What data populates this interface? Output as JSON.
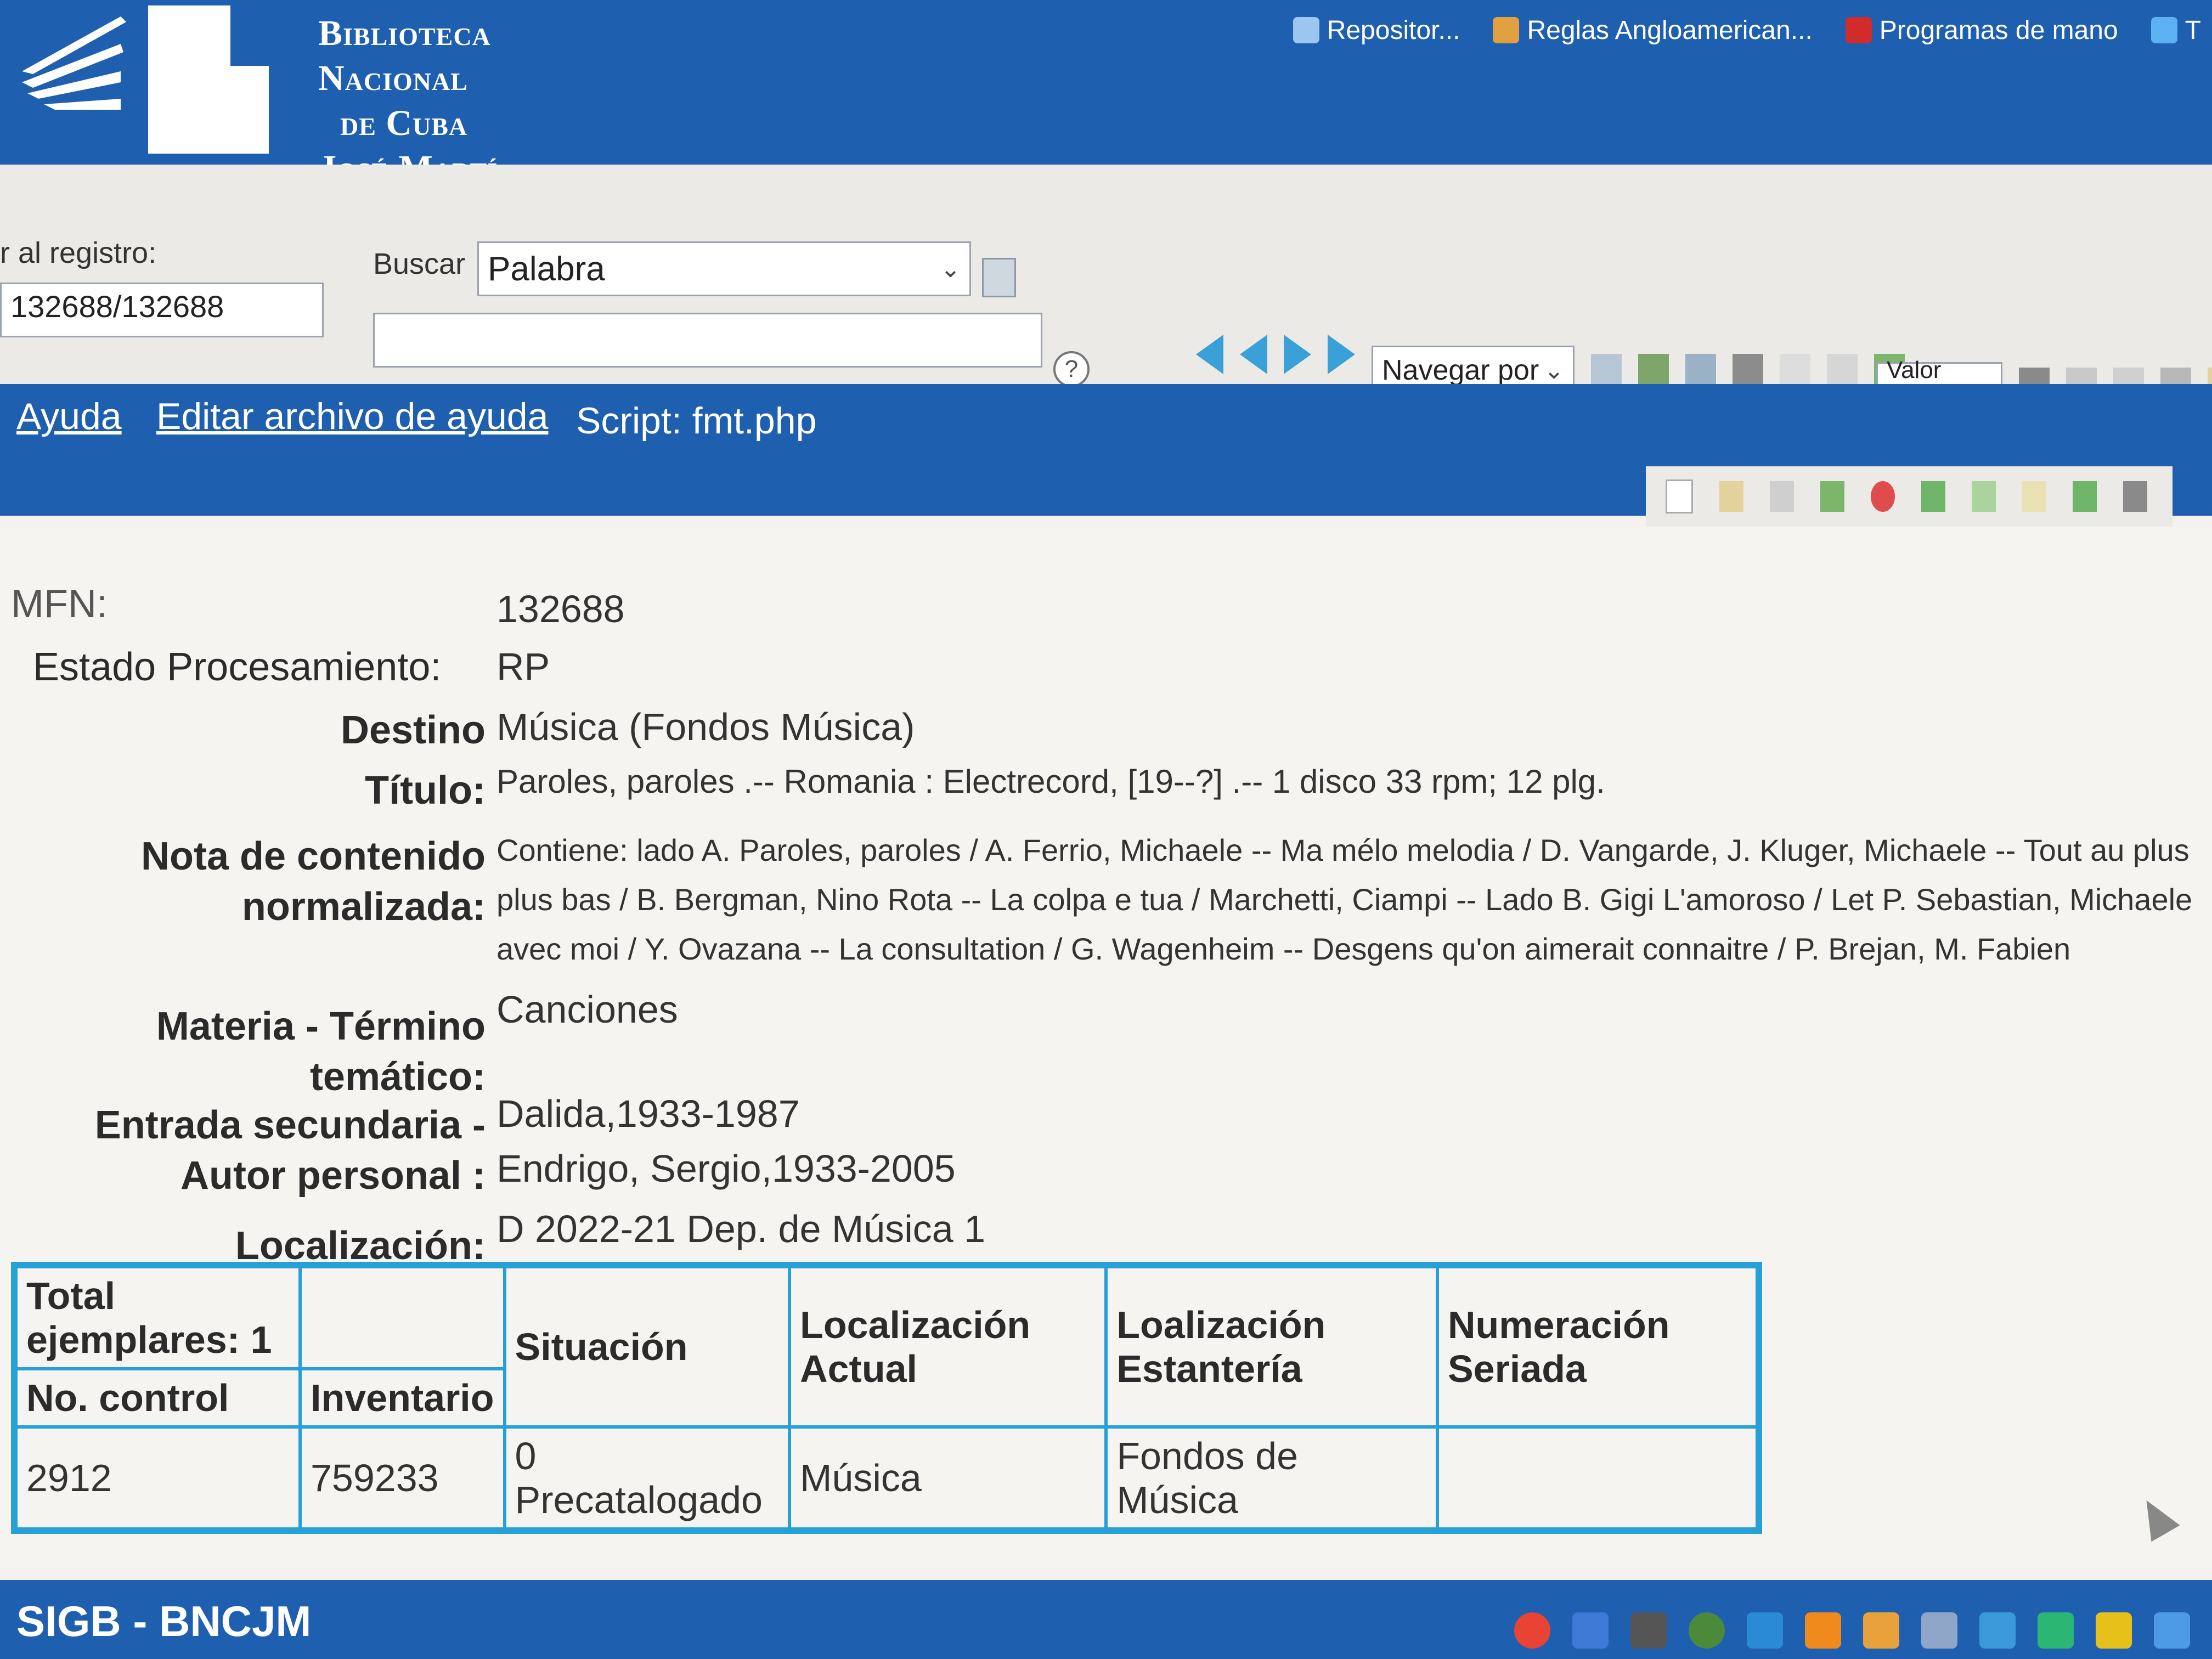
{
  "logo": {
    "lines": [
      "Biblioteca",
      "Nacional",
      "de Cuba",
      "José Martí"
    ]
  },
  "bookmarks": [
    {
      "label": "Repositor...",
      "icon": "repository-icon",
      "color": "#9cc5f0"
    },
    {
      "label": "Reglas Angloamerican...",
      "icon": "book-icon",
      "color": "#e0a040"
    },
    {
      "label": "Programas de mano",
      "icon": "pdf-icon",
      "color": "#d22b2b"
    },
    {
      "label": "T",
      "icon": "twitter-icon",
      "color": "#5bb1f1"
    }
  ],
  "toolbar": {
    "registro_label": "r al registro:",
    "registro_value": "132688/132688",
    "buscar_label": "Buscar",
    "buscar_select": "Palabra",
    "search_value": "",
    "help_symbol": "?",
    "navegar_select": "Navegar por",
    "valor_select": "Valor por"
  },
  "links": {
    "ayuda": "Ayuda",
    "editar": "Editar archivo de ayuda",
    "script": "Script: fmt.php"
  },
  "record": {
    "mfn_label": "MFN:",
    "mfn_value": "132688",
    "estado_label": "Estado Procesamiento:",
    "estado_value": "RP",
    "destino_label": "Destino",
    "destino_value": "Música (Fondos Música)",
    "titulo_label": "Título:",
    "titulo_value": "Paroles, paroles .-- Romania : Electrecord, [19--?] .-- 1 disco 33 rpm; 12 plg.",
    "nota_label_1": "Nota de contenido",
    "nota_label_2": "normalizada:",
    "nota_line_1": "Contiene: lado A. Paroles, paroles / A. Ferrio, Michaele -- Ma mélo melodia / D. Vangarde, J. Kluger, Michaele -- Tout au plus / Pintucci, Michaele --",
    "nota_line_2": "plus bas / B. Bergman, Nino Rota -- La colpa e tua / Marchetti, Ciampi -- Lado B. Gigi L'amoroso / Let P. Sebastian, Michaele -- Vado via / L. Albert",
    "nota_line_3": "avec moi / Y. Ovazana -- La consultation / G. Wagenheim -- Desgens qu'on aimerait connaitre / P. Brejan, M. Fabien",
    "materia_label_1": "Materia - Término",
    "materia_label_2": "temático:",
    "materia_value": "Canciones",
    "entrada_label_1": "Entrada secundaria -",
    "entrada_label_2": "Autor personal :",
    "entrada_value_1": "Dalida,1933-1987",
    "entrada_value_2": "Endrigo, Sergio,1933-2005",
    "localizacion_label": "Localización:",
    "localizacion_value": "D 2022-21 Dep. de Música 1"
  },
  "holdings": {
    "total_label": "Total ejemplares:",
    "total_value": "1",
    "headers": [
      "No. control",
      "Inventario",
      "Situación",
      "Localización Actual",
      "Loalización Estantería",
      "Numeración Seriada"
    ],
    "rows": [
      [
        "2912",
        "759233",
        "0 Precatalogado",
        "Música",
        "Fondos de Música",
        ""
      ]
    ]
  },
  "footer": {
    "brand": "SIGB - BNCJM"
  },
  "taskbar_icons": [
    {
      "name": "chrome-icon",
      "color": "#e94335"
    },
    {
      "name": "network-icon",
      "color": "#3c7ad6"
    },
    {
      "name": "lock-icon",
      "color": "#555555"
    },
    {
      "name": "globe-icon",
      "color": "#4a8a3a"
    },
    {
      "name": "app-icon",
      "color": "#2b8ad6"
    },
    {
      "name": "vlc-icon",
      "color": "#f08a1c"
    },
    {
      "name": "document-icon",
      "color": "#e9a23b"
    },
    {
      "name": "browser-icon",
      "color": "#8fa6c9"
    },
    {
      "name": "files-icon",
      "color": "#3a9ad9"
    },
    {
      "name": "paint-icon",
      "color": "#2bb673"
    },
    {
      "name": "notes-icon",
      "color": "#e6c11a"
    },
    {
      "name": "window-icon",
      "color": "#4d9be6"
    }
  ]
}
